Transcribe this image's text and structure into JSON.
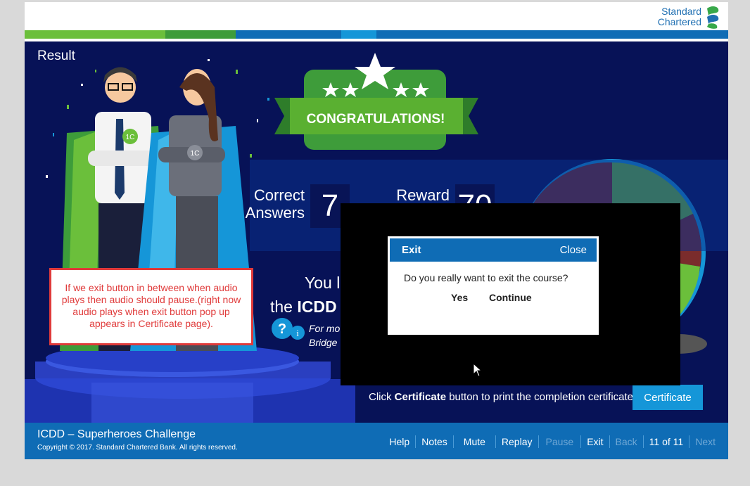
{
  "brand": {
    "line1": "Standard",
    "line2": "Chartered"
  },
  "colors": {
    "navy": "#071257",
    "footer_blue": "#0f6cb5",
    "green": "#5ab031",
    "accent_blue": "#1596d8",
    "annotation_red": "#e03a3a"
  },
  "stage": {
    "heading": "Result",
    "congrats": "CONGRATULATIONS!",
    "correct_label_1": "Correct",
    "correct_label_2": "Answers",
    "correct_value": "7",
    "reward_label": "Reward",
    "reward_value": "70",
    "you_line1": "You l",
    "you_line2_prefix": "the ",
    "you_line2_bold": "ICDD",
    "more_info_line1": "For mo",
    "more_info_line2": "Bridge",
    "certificate_prefix": "Click ",
    "certificate_bold": "Certificate",
    "certificate_suffix": " button to print the completion certificate.",
    "certificate_button": "Certificate"
  },
  "annotation": "If we exit button in between when audio plays then audio should pause.(right now audio plays when exit button pop up appears in Certificate page).",
  "dialog": {
    "title": "Exit",
    "close": "Close",
    "message": "Do you really want to exit the course?",
    "yes": "Yes",
    "continue": "Continue"
  },
  "footer": {
    "title": "ICDD – Superheroes Challenge",
    "copyright": "Copyright © 2017. Standard Chartered Bank. All rights reserved.",
    "nav": {
      "help": "Help",
      "notes": "Notes",
      "mute": "Mute",
      "replay": "Replay",
      "pause": "Pause",
      "exit": "Exit",
      "back": "Back",
      "pager": "11 of 11",
      "next": "Next"
    }
  }
}
